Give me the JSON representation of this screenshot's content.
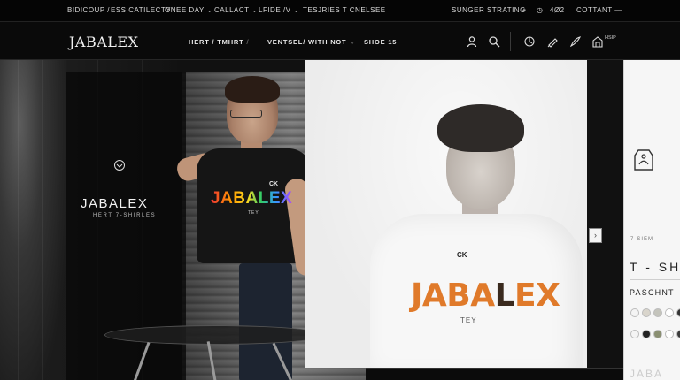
{
  "utility_bar": {
    "items": [
      {
        "label": "BIDICOUP",
        "suffix": "/"
      },
      {
        "label": "ESS CATILECTY",
        "suffix": ""
      },
      {
        "label": "ONEE DAY",
        "suffix": "⌄"
      },
      {
        "label": "CALLACT",
        "suffix": "⌄"
      },
      {
        "label": "LFIDE /V",
        "suffix": "⌄"
      },
      {
        "label": "TESJRIES T CNELSEE",
        "suffix": ""
      },
      {
        "label": "SUNGER STRATING",
        "suffix": ""
      },
      {
        "label": "⌕",
        "suffix": ""
      },
      {
        "label": "◷",
        "suffix": ""
      },
      {
        "label": "4Ø2",
        "suffix": ""
      },
      {
        "label": "COTTANT",
        "suffix": "—"
      }
    ]
  },
  "header": {
    "logo": "JABALEX",
    "nav": [
      {
        "label": "HERT / TMHRT",
        "chevron": "/"
      },
      {
        "label": "VENTSEL/ WITH NOT",
        "chevron": "⌄"
      },
      {
        "label": "SHOE 15",
        "chevron": ""
      }
    ],
    "help_label": "HSIP"
  },
  "hero": {
    "overlay_brand": "JABALEX",
    "overlay_subtitle": "HERT 7-SHIRLES",
    "model1_print": "JABALEX",
    "model1_print_tag": "CK",
    "model1_print_sub": "TEY",
    "model2_print_a": "JABA",
    "model2_print_b": "L",
    "model2_print_c": "EX",
    "model2_print_tag": "CK",
    "model2_print_sub": "TEY",
    "carousel_next": "›"
  },
  "product": {
    "eyebrow": "7-SIEM",
    "title": "T - SHI",
    "label": "PASCHNT",
    "swatches_row1": [
      "#f4f4f4",
      "#d9d5cc",
      "#c4c4bc",
      "#ffffff",
      "#333333"
    ],
    "swatches_row2": [
      "#f4f4f4",
      "#222222",
      "#8a8f72",
      "#ffffff",
      "#3a3a3a"
    ],
    "footer": "JABA"
  }
}
